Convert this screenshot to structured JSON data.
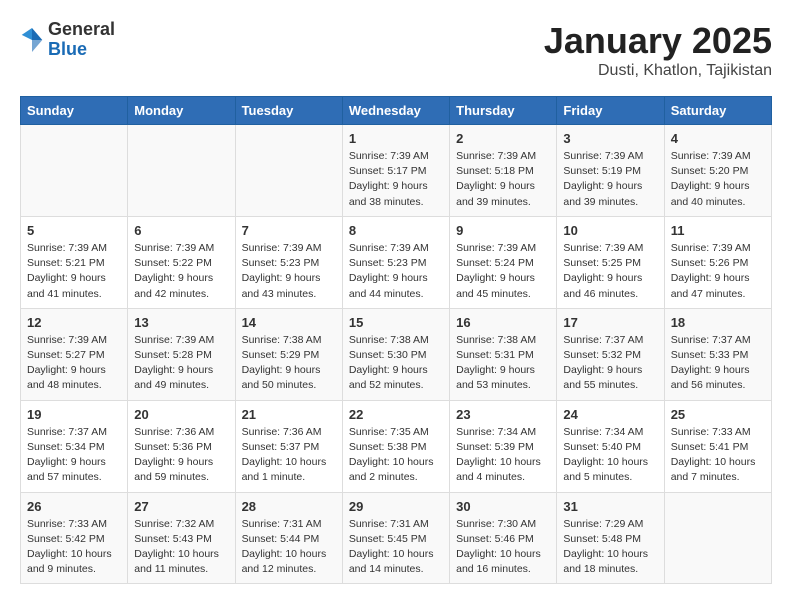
{
  "header": {
    "logo_line1": "General",
    "logo_line2": "Blue",
    "main_title": "January 2025",
    "subtitle": "Dusti, Khatlon, Tajikistan"
  },
  "days_of_week": [
    "Sunday",
    "Monday",
    "Tuesday",
    "Wednesday",
    "Thursday",
    "Friday",
    "Saturday"
  ],
  "weeks": [
    [
      {
        "day": "",
        "info": ""
      },
      {
        "day": "",
        "info": ""
      },
      {
        "day": "",
        "info": ""
      },
      {
        "day": "1",
        "info": "Sunrise: 7:39 AM\nSunset: 5:17 PM\nDaylight: 9 hours\nand 38 minutes."
      },
      {
        "day": "2",
        "info": "Sunrise: 7:39 AM\nSunset: 5:18 PM\nDaylight: 9 hours\nand 39 minutes."
      },
      {
        "day": "3",
        "info": "Sunrise: 7:39 AM\nSunset: 5:19 PM\nDaylight: 9 hours\nand 39 minutes."
      },
      {
        "day": "4",
        "info": "Sunrise: 7:39 AM\nSunset: 5:20 PM\nDaylight: 9 hours\nand 40 minutes."
      }
    ],
    [
      {
        "day": "5",
        "info": "Sunrise: 7:39 AM\nSunset: 5:21 PM\nDaylight: 9 hours\nand 41 minutes."
      },
      {
        "day": "6",
        "info": "Sunrise: 7:39 AM\nSunset: 5:22 PM\nDaylight: 9 hours\nand 42 minutes."
      },
      {
        "day": "7",
        "info": "Sunrise: 7:39 AM\nSunset: 5:23 PM\nDaylight: 9 hours\nand 43 minutes."
      },
      {
        "day": "8",
        "info": "Sunrise: 7:39 AM\nSunset: 5:23 PM\nDaylight: 9 hours\nand 44 minutes."
      },
      {
        "day": "9",
        "info": "Sunrise: 7:39 AM\nSunset: 5:24 PM\nDaylight: 9 hours\nand 45 minutes."
      },
      {
        "day": "10",
        "info": "Sunrise: 7:39 AM\nSunset: 5:25 PM\nDaylight: 9 hours\nand 46 minutes."
      },
      {
        "day": "11",
        "info": "Sunrise: 7:39 AM\nSunset: 5:26 PM\nDaylight: 9 hours\nand 47 minutes."
      }
    ],
    [
      {
        "day": "12",
        "info": "Sunrise: 7:39 AM\nSunset: 5:27 PM\nDaylight: 9 hours\nand 48 minutes."
      },
      {
        "day": "13",
        "info": "Sunrise: 7:39 AM\nSunset: 5:28 PM\nDaylight: 9 hours\nand 49 minutes."
      },
      {
        "day": "14",
        "info": "Sunrise: 7:38 AM\nSunset: 5:29 PM\nDaylight: 9 hours\nand 50 minutes."
      },
      {
        "day": "15",
        "info": "Sunrise: 7:38 AM\nSunset: 5:30 PM\nDaylight: 9 hours\nand 52 minutes."
      },
      {
        "day": "16",
        "info": "Sunrise: 7:38 AM\nSunset: 5:31 PM\nDaylight: 9 hours\nand 53 minutes."
      },
      {
        "day": "17",
        "info": "Sunrise: 7:37 AM\nSunset: 5:32 PM\nDaylight: 9 hours\nand 55 minutes."
      },
      {
        "day": "18",
        "info": "Sunrise: 7:37 AM\nSunset: 5:33 PM\nDaylight: 9 hours\nand 56 minutes."
      }
    ],
    [
      {
        "day": "19",
        "info": "Sunrise: 7:37 AM\nSunset: 5:34 PM\nDaylight: 9 hours\nand 57 minutes."
      },
      {
        "day": "20",
        "info": "Sunrise: 7:36 AM\nSunset: 5:36 PM\nDaylight: 9 hours\nand 59 minutes."
      },
      {
        "day": "21",
        "info": "Sunrise: 7:36 AM\nSunset: 5:37 PM\nDaylight: 10 hours\nand 1 minute."
      },
      {
        "day": "22",
        "info": "Sunrise: 7:35 AM\nSunset: 5:38 PM\nDaylight: 10 hours\nand 2 minutes."
      },
      {
        "day": "23",
        "info": "Sunrise: 7:34 AM\nSunset: 5:39 PM\nDaylight: 10 hours\nand 4 minutes."
      },
      {
        "day": "24",
        "info": "Sunrise: 7:34 AM\nSunset: 5:40 PM\nDaylight: 10 hours\nand 5 minutes."
      },
      {
        "day": "25",
        "info": "Sunrise: 7:33 AM\nSunset: 5:41 PM\nDaylight: 10 hours\nand 7 minutes."
      }
    ],
    [
      {
        "day": "26",
        "info": "Sunrise: 7:33 AM\nSunset: 5:42 PM\nDaylight: 10 hours\nand 9 minutes."
      },
      {
        "day": "27",
        "info": "Sunrise: 7:32 AM\nSunset: 5:43 PM\nDaylight: 10 hours\nand 11 minutes."
      },
      {
        "day": "28",
        "info": "Sunrise: 7:31 AM\nSunset: 5:44 PM\nDaylight: 10 hours\nand 12 minutes."
      },
      {
        "day": "29",
        "info": "Sunrise: 7:31 AM\nSunset: 5:45 PM\nDaylight: 10 hours\nand 14 minutes."
      },
      {
        "day": "30",
        "info": "Sunrise: 7:30 AM\nSunset: 5:46 PM\nDaylight: 10 hours\nand 16 minutes."
      },
      {
        "day": "31",
        "info": "Sunrise: 7:29 AM\nSunset: 5:48 PM\nDaylight: 10 hours\nand 18 minutes."
      },
      {
        "day": "",
        "info": ""
      }
    ]
  ]
}
